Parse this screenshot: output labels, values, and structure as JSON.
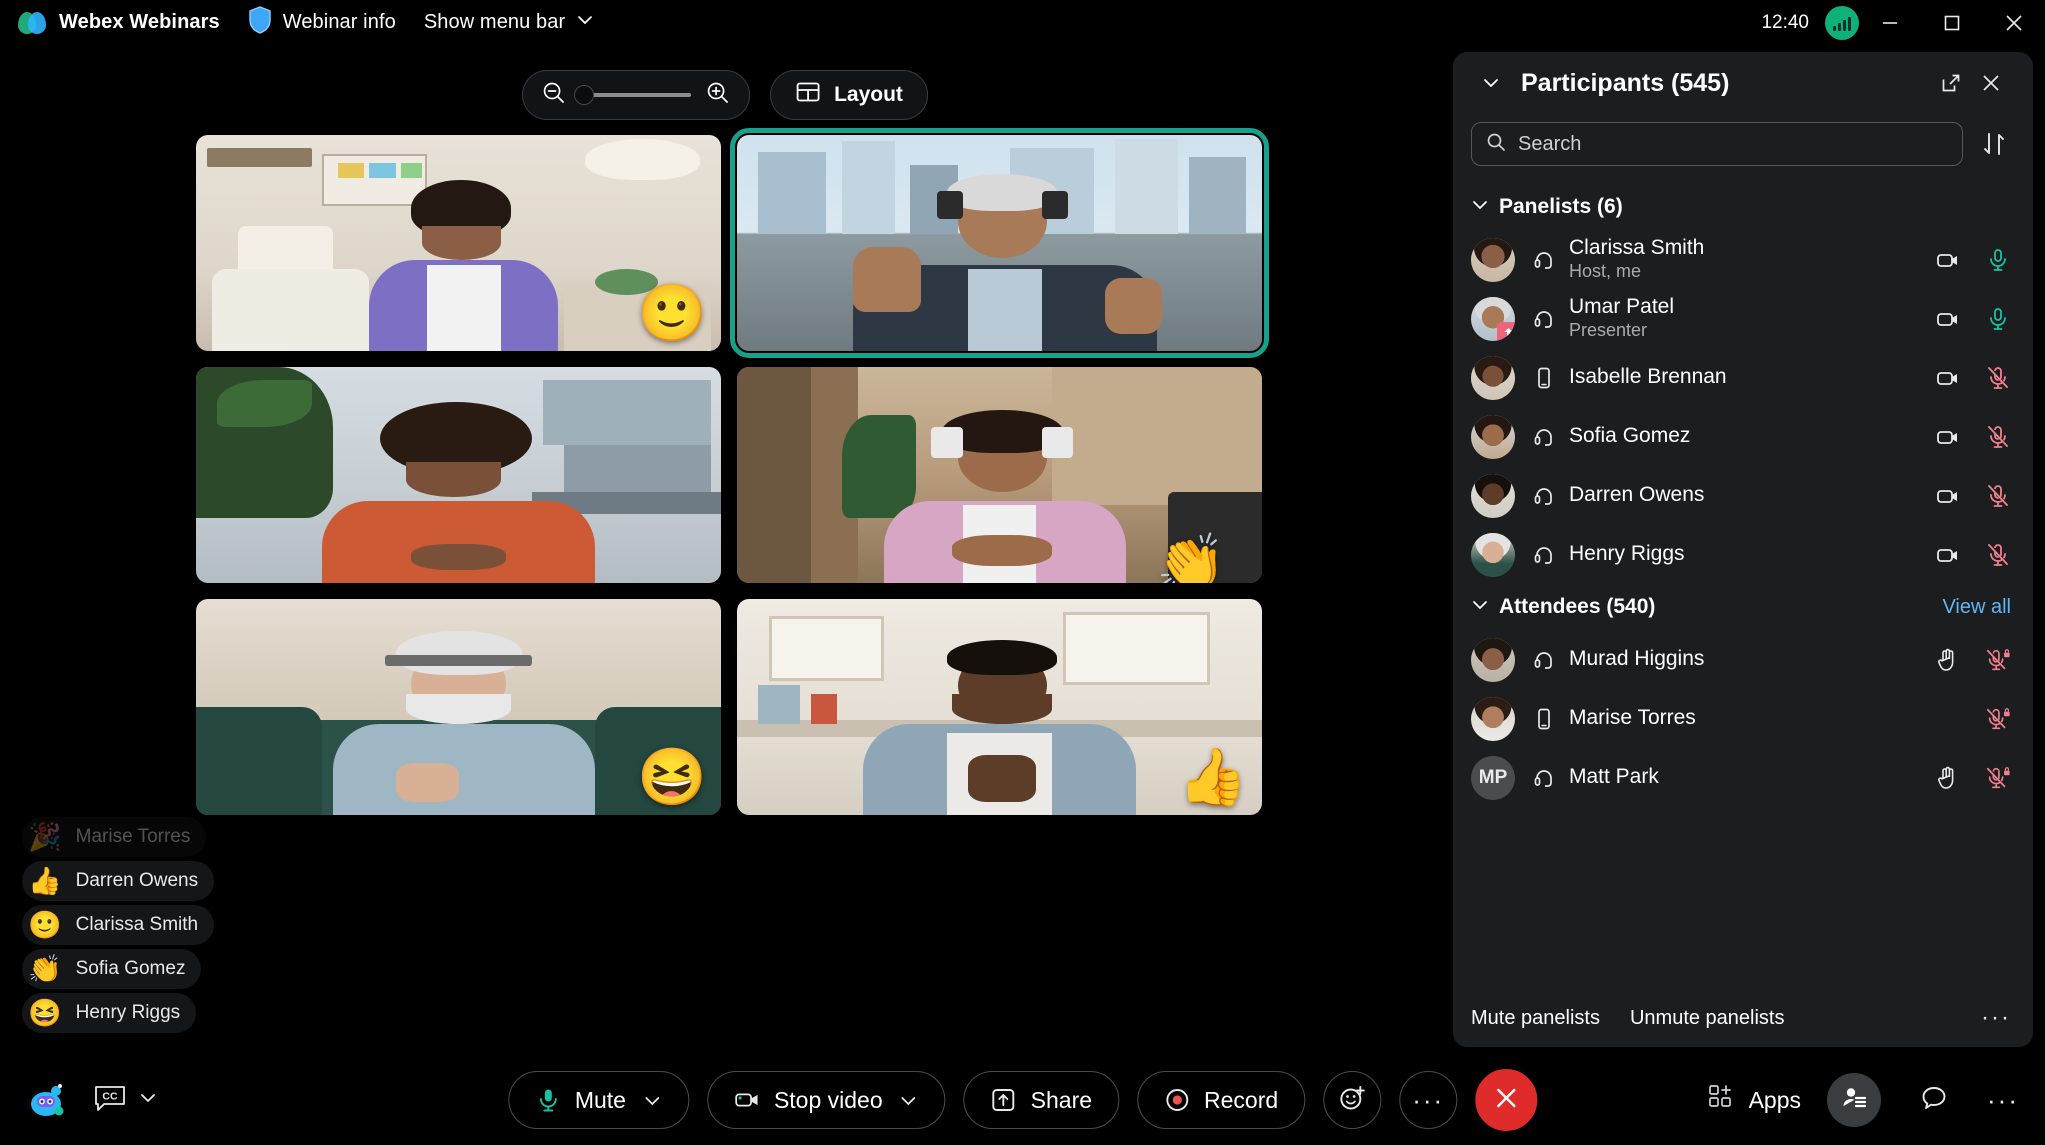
{
  "titlebar": {
    "app_name": "Webex Webinars",
    "webinar_info": "Webinar info",
    "menu_bar": "Show menu bar",
    "clock": "12:40",
    "icons": {
      "logo": "webex-logo",
      "shield": "shield-icon",
      "chevron": "chevron-down-icon",
      "signal": "network-signal-icon",
      "minimize": "minimize-icon",
      "maximize": "maximize-icon",
      "close": "close-icon"
    }
  },
  "stage": {
    "zoom_control": {
      "zoom_out_icon": "zoom-out-icon",
      "zoom_in_icon": "zoom-in-icon",
      "slider_value": 0
    },
    "layout_button": "Layout",
    "active_tile_color": "#17a08a",
    "tiles": [
      {
        "id": "tile-1",
        "reaction": "🙂",
        "active": false
      },
      {
        "id": "tile-2",
        "reaction": "",
        "active": true
      },
      {
        "id": "tile-3",
        "reaction": "",
        "active": false
      },
      {
        "id": "tile-4",
        "reaction": "👏",
        "active": false
      },
      {
        "id": "tile-5",
        "reaction": "😆",
        "active": false
      },
      {
        "id": "tile-6",
        "reaction": "👍",
        "active": false
      }
    ]
  },
  "reaction_toasts": [
    {
      "emoji": "🎉",
      "name": "Marise Torres",
      "fading": true
    },
    {
      "emoji": "👍",
      "name": "Darren Owens",
      "fading": false
    },
    {
      "emoji": "🙂",
      "name": "Clarissa Smith",
      "fading": false
    },
    {
      "emoji": "👏",
      "name": "Sofia Gomez",
      "fading": false
    },
    {
      "emoji": "😆",
      "name": "Henry Riggs",
      "fading": false
    }
  ],
  "panel": {
    "title": "Participants (545)",
    "collapse_icon": "chevron-down-icon",
    "popout_icon": "popout-icon",
    "close_icon": "close-icon",
    "search_placeholder": "Search",
    "search_value": "",
    "search_icon": "search-icon",
    "sort_icon": "sort-icon",
    "sections": [
      {
        "id": "panelists",
        "title": "Panelists (6)",
        "action": "",
        "rows": [
          {
            "name": "Clarissa Smith",
            "sub": "Host, me",
            "device": "headset",
            "avatar": "photo",
            "initials": "",
            "badge": "",
            "hand": false,
            "video": "on",
            "mic": "unmuted",
            "mic_locked": false
          },
          {
            "name": "Umar Patel",
            "sub": "Presenter",
            "device": "headset",
            "avatar": "photo",
            "initials": "",
            "badge": "presenter",
            "hand": false,
            "video": "on",
            "mic": "unmuted",
            "mic_locked": false
          },
          {
            "name": "Isabelle Brennan",
            "sub": "",
            "device": "mobile",
            "avatar": "photo",
            "initials": "",
            "badge": "",
            "hand": false,
            "video": "on",
            "mic": "muted",
            "mic_locked": false
          },
          {
            "name": "Sofia Gomez",
            "sub": "",
            "device": "headset",
            "avatar": "photo",
            "initials": "",
            "badge": "",
            "hand": false,
            "video": "on",
            "mic": "muted",
            "mic_locked": false
          },
          {
            "name": "Darren Owens",
            "sub": "",
            "device": "headset",
            "avatar": "photo",
            "initials": "",
            "badge": "",
            "hand": false,
            "video": "on",
            "mic": "muted",
            "mic_locked": false
          },
          {
            "name": "Henry Riggs",
            "sub": "",
            "device": "headset",
            "avatar": "photo",
            "initials": "",
            "badge": "",
            "hand": false,
            "video": "on",
            "mic": "muted",
            "mic_locked": false
          }
        ]
      },
      {
        "id": "attendees",
        "title": "Attendees (540)",
        "action": "View all",
        "rows": [
          {
            "name": "Murad Higgins",
            "sub": "",
            "device": "headset",
            "avatar": "photo",
            "initials": "",
            "badge": "",
            "hand": true,
            "video": "none",
            "mic": "muted",
            "mic_locked": true
          },
          {
            "name": "Marise Torres",
            "sub": "",
            "device": "mobile",
            "avatar": "photo",
            "initials": "",
            "badge": "",
            "hand": false,
            "video": "none",
            "mic": "muted",
            "mic_locked": true
          },
          {
            "name": "Matt Park",
            "sub": "",
            "device": "headset",
            "avatar": "initials",
            "initials": "MP",
            "badge": "",
            "hand": true,
            "video": "none",
            "mic": "muted",
            "mic_locked": true
          }
        ]
      }
    ],
    "footer": {
      "mute_all": "Mute panelists",
      "unmute_all": "Unmute panelists",
      "more": "···"
    }
  },
  "controlbar": {
    "assistant_icon": "ai-assistant-icon",
    "captions_label": "CC",
    "captions_chevron": "chevron-down-icon",
    "mute": "Mute",
    "stop_video": "Stop video",
    "share": "Share",
    "record": "Record",
    "reactions_icon": "reactions-icon",
    "more_icon": "more-icon",
    "leave_icon": "leave-icon",
    "apps": "Apps",
    "participants_icon": "participants-icon",
    "chat_icon": "chat-icon",
    "right_more_icon": "more-icon",
    "record_color": "#ef5350",
    "leave_color": "#e02b2b",
    "mic_color": "#17c3a0"
  }
}
